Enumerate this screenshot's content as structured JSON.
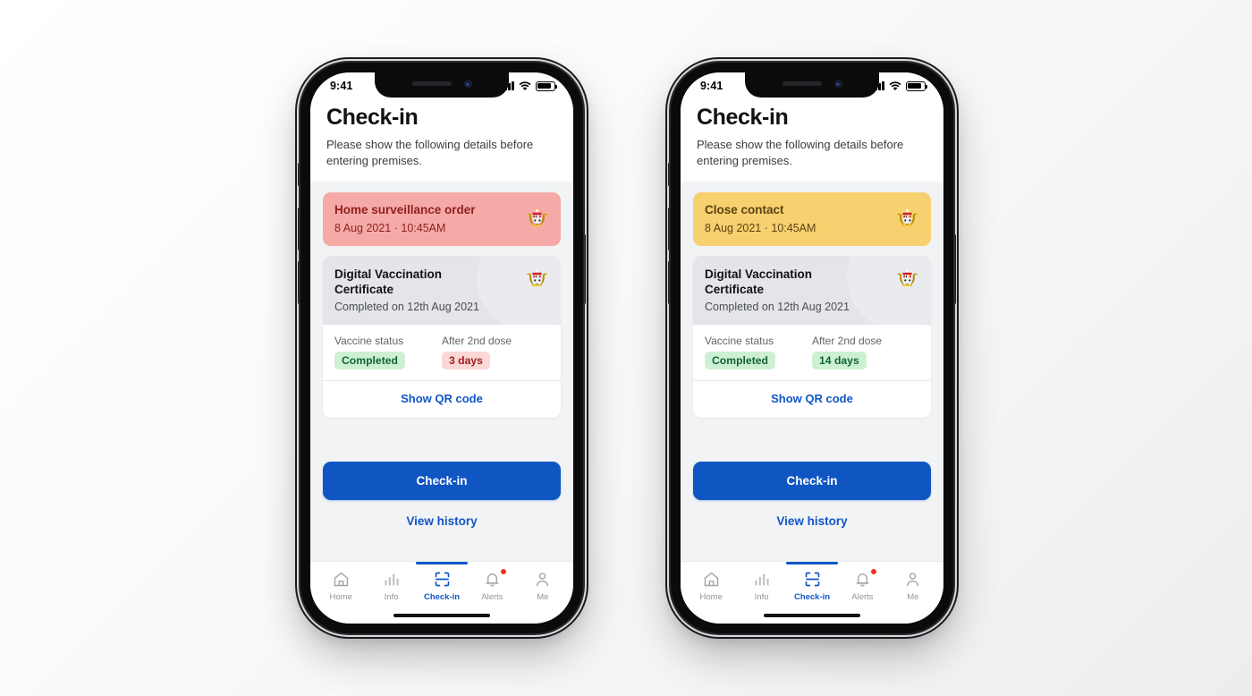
{
  "background": {
    "color_from": "#ffffff",
    "color_to": "#eceded"
  },
  "accent": {
    "blue": "#1156c6",
    "button_blue": "#0f56c3",
    "alert_red": "#ef3124"
  },
  "status_bar": {
    "time": "9:41",
    "signal_icon": "cellular-signal-icon",
    "wifi_icon": "wifi-icon",
    "battery_icon": "battery-icon"
  },
  "page": {
    "title": "Check-in",
    "subtitle": "Please show the following details before entering premises."
  },
  "certificate": {
    "title": "Digital Vaccination Certificate",
    "subtitle": "Completed on 12th Aug 2021",
    "emblem_icon": "malaysia-coat-of-arms-icon",
    "vaccine_status_label": "Vaccine status",
    "vaccine_status_value": "Completed",
    "after_dose_label": "After 2nd dose",
    "qr_link": "Show QR code"
  },
  "actions": {
    "checkin_button": "Check-in",
    "view_history_link": "View history"
  },
  "tabs": [
    {
      "label": "Home",
      "icon": "home-icon",
      "active": false,
      "badge": false
    },
    {
      "label": "Info",
      "icon": "bar-chart-icon",
      "active": false,
      "badge": false
    },
    {
      "label": "Check-in",
      "icon": "qr-scan-icon",
      "active": true,
      "badge": false
    },
    {
      "label": "Alerts",
      "icon": "bell-icon",
      "active": false,
      "badge": true
    },
    {
      "label": "Me",
      "icon": "person-icon",
      "active": false,
      "badge": false
    }
  ],
  "phones": [
    {
      "id": "left",
      "banner": {
        "title": "Home surveillance order",
        "date": "8 Aug 2021 · 10:45AM",
        "bg": "#f5aaa8",
        "title_color": "#8e1f1d",
        "date_color": "#8e1f1d"
      },
      "after_dose_value": "3 days",
      "after_dose_chip": "red"
    },
    {
      "id": "right",
      "banner": {
        "title": "Close contact",
        "date": "8 Aug 2021 · 10:45AM",
        "bg": "#f7d070",
        "title_color": "#5c4410",
        "date_color": "#5c4410"
      },
      "after_dose_value": "14 days",
      "after_dose_chip": "green"
    }
  ]
}
